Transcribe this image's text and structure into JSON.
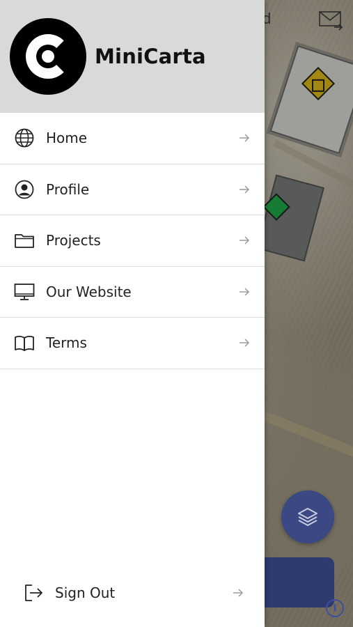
{
  "app": {
    "brand_name": "MiniCarta"
  },
  "background": {
    "title_fragment": "d"
  },
  "menu": {
    "items": [
      {
        "label": "Home",
        "icon": "globe-icon"
      },
      {
        "label": "Profile",
        "icon": "user-circle-icon"
      },
      {
        "label": "Projects",
        "icon": "folder-icon"
      },
      {
        "label": "Our Website",
        "icon": "monitor-icon"
      },
      {
        "label": "Terms",
        "icon": "book-icon"
      }
    ],
    "signout_label": "Sign Out"
  },
  "colors": {
    "drawer_header": "#d9d9d9",
    "accent_blue": "#3b4883",
    "marker_yellow": "#e8c21f",
    "marker_green": "#21b24a"
  }
}
